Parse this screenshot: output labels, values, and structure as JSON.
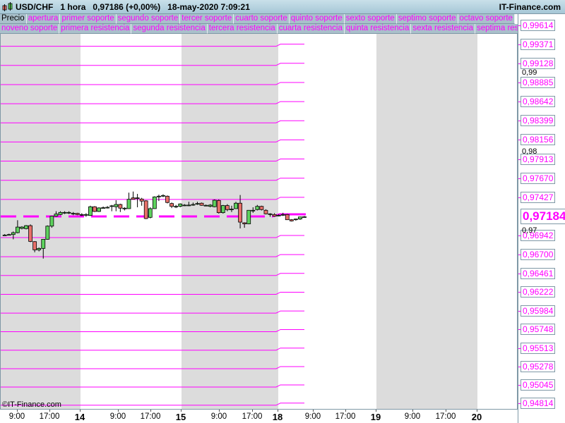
{
  "header": {
    "symbol": "USD/CHF",
    "timeframe": "1 hora",
    "price": "0,97186 (+0,00%)",
    "datetime": "18-may-2020 7:09:21",
    "brand": "IT-Finance.com"
  },
  "legend": {
    "row1": [
      "Precio",
      "apertura",
      "primer soporte",
      "segundo soporte",
      "tercer soporte",
      "cuarto soporte",
      "quinto soporte",
      "sexto soporte",
      "septimo soporte",
      "octavo soporte"
    ],
    "row2": [
      "noveno soporte",
      "primera resistencia",
      "segunda resistencia",
      "tercera resistencia",
      "cuarta resistencia",
      "quinta resistencia",
      "sexta resistencia",
      "septima resistencia"
    ]
  },
  "colors": {
    "level": "#ff00ff",
    "up": "#5ed35e",
    "down": "#e8706a",
    "band": "#d9d9d9"
  },
  "price_axis": {
    "levels": [
      "0,99614",
      "0,99371",
      "0,99128",
      "0,98885",
      "0,98642",
      "0,98399",
      "0,98156",
      "0,97913",
      "0,97670",
      "0,97427",
      "0,96942",
      "0,96700",
      "0,96461",
      "0,96222",
      "0,95984",
      "0,95748",
      "0,95513",
      "0,95278",
      "0,95045",
      "0,94814"
    ],
    "grid": [
      "0,99",
      "0,98",
      "0,97"
    ],
    "current": "0,97184"
  },
  "time_axis": [
    {
      "t": "9:00",
      "b": false
    },
    {
      "t": "17:00",
      "b": false
    },
    {
      "t": "14",
      "b": true
    },
    {
      "t": "9:00",
      "b": false
    },
    {
      "t": "17:00",
      "b": false
    },
    {
      "t": "15",
      "b": true
    },
    {
      "t": "9:00",
      "b": false
    },
    {
      "t": "17:00",
      "b": false
    },
    {
      "t": "18",
      "b": true
    },
    {
      "t": "9:00",
      "b": false
    },
    {
      "t": "17:00",
      "b": false
    },
    {
      "t": "19",
      "b": true
    },
    {
      "t": "9:00",
      "b": false
    },
    {
      "t": "17:00",
      "b": false
    },
    {
      "t": "20",
      "b": true
    }
  ],
  "copyright": "©IT-Finance.com",
  "candles": [
    [
      0.96948,
      0.9696,
      0.9694,
      0.96948
    ],
    [
      0.96954,
      0.96965,
      0.96945,
      0.96954
    ],
    [
      0.96954,
      0.96993,
      0.96894,
      0.96978
    ],
    [
      0.96978,
      0.97136,
      0.9697,
      0.97049
    ],
    [
      0.97032,
      0.9706,
      0.9702,
      0.97049
    ],
    [
      0.97029,
      0.97075,
      0.9702,
      0.97067
    ],
    [
      0.97067,
      0.97083,
      0.96858,
      0.96867
    ],
    [
      0.96864,
      0.9687,
      0.96729,
      0.9676
    ],
    [
      0.9676,
      0.9679,
      0.9674,
      0.96778
    ],
    [
      0.96778,
      0.96894,
      0.96649,
      0.96894
    ],
    [
      0.96894,
      0.9707,
      0.9689,
      0.97061
    ],
    [
      0.97061,
      0.9719,
      0.9704,
      0.97187
    ],
    [
      0.97187,
      0.9725,
      0.9718,
      0.97214
    ],
    [
      0.97208,
      0.9725,
      0.972,
      0.97235
    ],
    [
      0.97235,
      0.9725,
      0.97215,
      0.97235
    ],
    [
      0.97235,
      0.9725,
      0.97215,
      0.97235
    ],
    [
      0.97223,
      0.9724,
      0.972,
      0.97223
    ],
    [
      0.97223,
      0.9723,
      0.972,
      0.97208
    ],
    [
      0.97208,
      0.97225,
      0.9719,
      0.97208
    ],
    [
      0.97208,
      0.97225,
      0.9718,
      0.97208
    ],
    [
      0.97196,
      0.9732,
      0.9719,
      0.97307
    ],
    [
      0.97307,
      0.97315,
      0.9724,
      0.97247
    ],
    [
      0.97247,
      0.973,
      0.9724,
      0.97292
    ],
    [
      0.97295,
      0.9731,
      0.97285,
      0.97295
    ],
    [
      0.973,
      0.97315,
      0.97285,
      0.973
    ],
    [
      0.97319,
      0.9733,
      0.9725,
      0.97319
    ],
    [
      0.97307,
      0.9739,
      0.9725,
      0.97336
    ],
    [
      0.97336,
      0.97345,
      0.9724,
      0.97289
    ],
    [
      0.97289,
      0.973,
      0.9726,
      0.97289
    ],
    [
      0.97283,
      0.97486,
      0.9728,
      0.97402
    ],
    [
      0.9742,
      0.975,
      0.974,
      0.97402
    ],
    [
      0.97411,
      0.9747,
      0.973,
      0.9742
    ],
    [
      0.97405,
      0.9742,
      0.9732,
      0.97379
    ],
    [
      0.97382,
      0.9739,
      0.9715,
      0.97157
    ],
    [
      0.97172,
      0.973,
      0.9716,
      0.97283
    ],
    [
      0.97283,
      0.9744,
      0.9728,
      0.97432
    ],
    [
      0.97441,
      0.9746,
      0.9738,
      0.97441
    ],
    [
      0.9745,
      0.97465,
      0.9743,
      0.9745
    ],
    [
      0.97441,
      0.9745,
      0.9735,
      0.97361
    ],
    [
      0.97348,
      0.9736,
      0.9729,
      0.97312
    ],
    [
      0.97312,
      0.9733,
      0.9729,
      0.97312
    ],
    [
      0.97312,
      0.9735,
      0.973,
      0.97343
    ],
    [
      0.97328,
      0.9734,
      0.97315,
      0.97328
    ],
    [
      0.97328,
      0.9737,
      0.97315,
      0.97328
    ],
    [
      0.97336,
      0.9736,
      0.9732,
      0.97336
    ],
    [
      0.97348,
      0.9737,
      0.9733,
      0.97348
    ],
    [
      0.97352,
      0.9736,
      0.9732,
      0.97325
    ],
    [
      0.97325,
      0.97335,
      0.97315,
      0.97325
    ],
    [
      0.97312,
      0.9734,
      0.973,
      0.97328
    ],
    [
      0.97307,
      0.974,
      0.973,
      0.9739
    ],
    [
      0.97387,
      0.974,
      0.9722,
      0.97232
    ],
    [
      0.97232,
      0.9733,
      0.9722,
      0.97322
    ],
    [
      0.97322,
      0.9734,
      0.9725,
      0.97271
    ],
    [
      0.97277,
      0.9732,
      0.9724,
      0.97277
    ],
    [
      0.97283,
      0.9737,
      0.9728,
      0.97352
    ],
    [
      0.97352,
      0.97456,
      0.97032,
      0.97112
    ],
    [
      0.97103,
      0.9711,
      0.9704,
      0.9709
    ],
    [
      0.9709,
      0.97265,
      0.97085,
      0.97262
    ],
    [
      0.97262,
      0.973,
      0.9723,
      0.97262
    ],
    [
      0.97271,
      0.9733,
      0.9726,
      0.97312
    ],
    [
      0.97312,
      0.9732,
      0.9726,
      0.97271
    ],
    [
      0.97262,
      0.97275,
      0.9721,
      0.97217
    ],
    [
      0.97217,
      0.97225,
      0.9718,
      0.97217
    ],
    [
      0.97208,
      0.97225,
      0.9718,
      0.97187
    ],
    [
      0.97199,
      0.9721,
      0.97185,
      0.97199
    ],
    [
      0.97208,
      0.9723,
      0.9719,
      0.97208
    ],
    [
      0.97208,
      0.97215,
      0.9714,
      0.97142
    ],
    [
      0.97142,
      0.9715,
      0.9712,
      0.97127
    ],
    [
      0.97142,
      0.97155,
      0.9713,
      0.97151
    ],
    [
      0.97151,
      0.9717,
      0.9714,
      0.97178
    ],
    [
      0.97178,
      0.9719,
      0.9717,
      0.9718
    ]
  ]
}
